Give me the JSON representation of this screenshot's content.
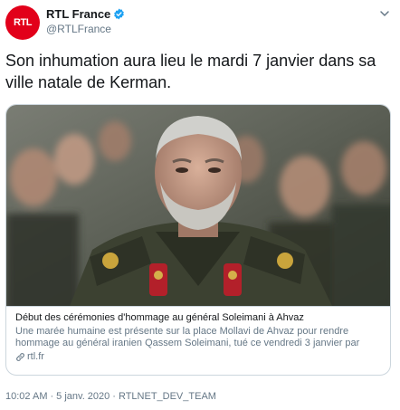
{
  "account": {
    "display_name": "RTL France",
    "handle": "@RTLFrance",
    "avatar_text": "RTL",
    "verified": true
  },
  "tweet": {
    "text": "Son inhumation aura lieu le mardi 7 janvier dans sa ville natale de Kerman."
  },
  "card": {
    "title": "Début des cérémonies d'hommage au général Soleimani à Ahvaz",
    "description": "Une marée humaine est présente sur la place Mollavi de Ahvaz pour rendre hommage au général iranien Qassem Soleimani, tué ce vendredi 3 janvier par un...",
    "domain": "rtl.fr",
    "image_icon": "photo-man-in-uniform"
  },
  "meta": {
    "time": "10:02 AM",
    "separator": "·",
    "date": "5 janv. 2020",
    "source": "RTLNET_DEV_TEAM"
  },
  "colors": {
    "brand_red": "#e2001a",
    "verified_blue": "#1da1f2",
    "text_primary": "#14171a",
    "text_secondary": "#657786",
    "border": "#ccd6dd"
  }
}
